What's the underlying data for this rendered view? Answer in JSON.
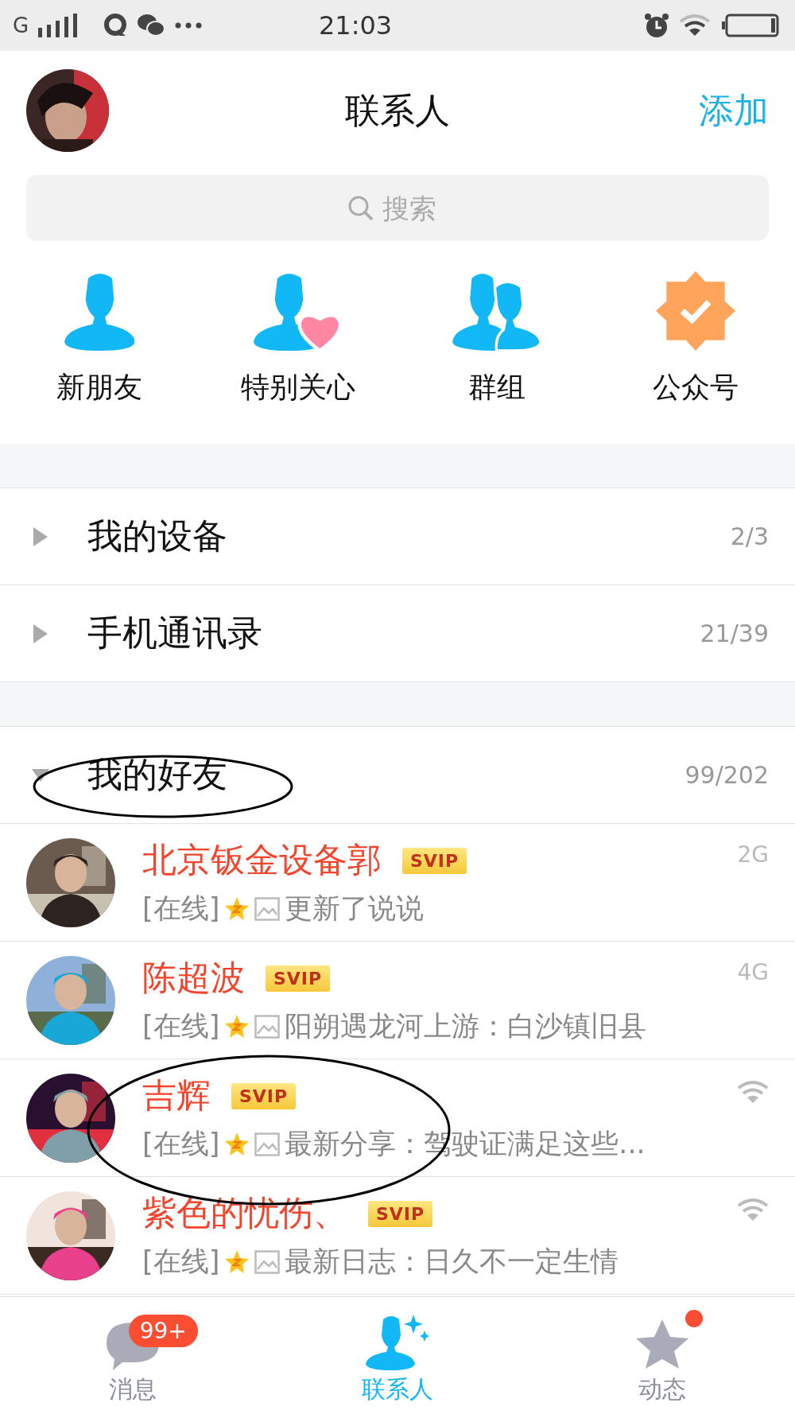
{
  "status_bar": {
    "carrier": "G",
    "time": "21:03"
  },
  "header": {
    "title": "联系人",
    "action": "添加"
  },
  "search": {
    "placeholder": "搜索"
  },
  "shortcuts": [
    {
      "label": "新朋友",
      "kind": "person"
    },
    {
      "label": "特别关心",
      "kind": "heart"
    },
    {
      "label": "群组",
      "kind": "group"
    },
    {
      "label": "公众号",
      "kind": "official"
    }
  ],
  "groups": [
    {
      "name": "我的设备",
      "count": "2/3",
      "expanded": false
    },
    {
      "name": "手机通讯录",
      "count": "21/39",
      "expanded": false
    }
  ],
  "friends_group": {
    "name": "我的好友",
    "count": "99/202",
    "expanded": true
  },
  "friends": [
    {
      "name": "北京钣金设备郭",
      "badge": "SVIP",
      "presence": "[在线]",
      "status": "更新了说说",
      "network": {
        "kind": "text",
        "label": "2G"
      }
    },
    {
      "name": "陈超波",
      "badge": "SVIP",
      "presence": "[在线]",
      "status": "阳朔遇龙河上游：白沙镇旧县",
      "network": {
        "kind": "text",
        "label": "4G"
      }
    },
    {
      "name": "吉辉",
      "badge": "SVIP",
      "presence": "[在线]",
      "status": "最新分享：驾驶证满足这些...",
      "network": {
        "kind": "wifi"
      }
    },
    {
      "name": "紫色的忧伤、",
      "badge": "SVIP",
      "presence": "[在线]",
      "status": "最新日志：日久不一定生情",
      "network": {
        "kind": "wifi"
      }
    }
  ],
  "tabs": [
    {
      "label": "消息",
      "kind": "chat",
      "selected": false,
      "badge": "99+",
      "dot": false
    },
    {
      "label": "联系人",
      "kind": "contacts",
      "selected": true,
      "dot": false
    },
    {
      "label": "动态",
      "kind": "star",
      "selected": false,
      "dot": true
    }
  ]
}
